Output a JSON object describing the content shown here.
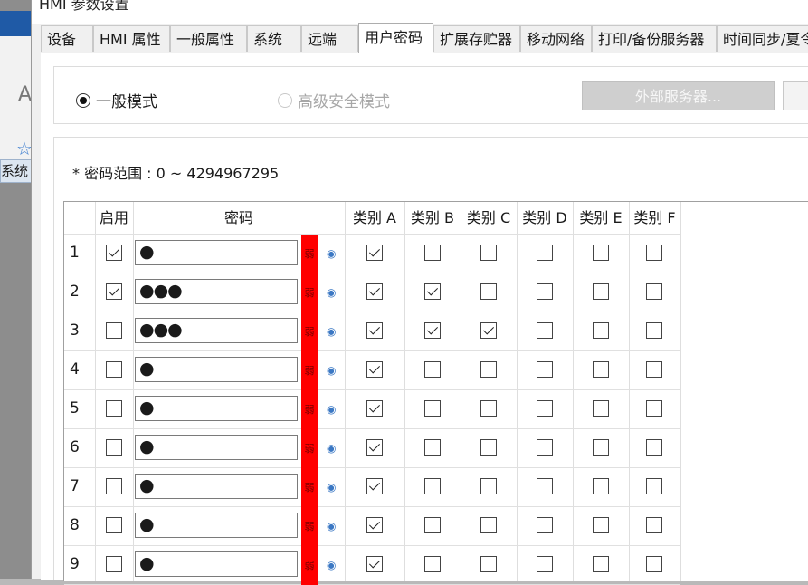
{
  "window": {
    "title": "HMI 参数设置"
  },
  "tabs": [
    "设备",
    "HMI 属性",
    "一般属性",
    "系统",
    "远端",
    "用户密码",
    "扩展存贮器",
    "移动网络",
    "打印/备份服务器",
    "时间同步/夏令"
  ],
  "active_tab": "用户密码",
  "background": {
    "left_tab": "系统"
  },
  "mode": {
    "general_label": "一般模式",
    "secure_label": "高级安全模式",
    "selected": "一般模式",
    "external_server_label": "外部服务器..."
  },
  "range_text": "* 密码范围 : 0 ~ 4294967295",
  "table": {
    "headers": {
      "enable": "启用",
      "password": "密码",
      "categories": [
        "类别 A",
        "类别 B",
        "类别 C",
        "类别 D",
        "类别 E",
        "类别 F"
      ]
    },
    "strength_label": "弱",
    "rows": [
      {
        "num": "1",
        "enabled": true,
        "password": "●",
        "cats": [
          true,
          false,
          false,
          false,
          false,
          false
        ]
      },
      {
        "num": "2",
        "enabled": true,
        "password": "●●●",
        "cats": [
          true,
          true,
          false,
          false,
          false,
          false
        ]
      },
      {
        "num": "3",
        "enabled": false,
        "password": "●●●",
        "cats": [
          true,
          true,
          true,
          false,
          false,
          false
        ]
      },
      {
        "num": "4",
        "enabled": false,
        "password": "●",
        "cats": [
          true,
          false,
          false,
          false,
          false,
          false
        ]
      },
      {
        "num": "5",
        "enabled": false,
        "password": "●",
        "cats": [
          true,
          false,
          false,
          false,
          false,
          false
        ]
      },
      {
        "num": "6",
        "enabled": false,
        "password": "●",
        "cats": [
          true,
          false,
          false,
          false,
          false,
          false
        ]
      },
      {
        "num": "7",
        "enabled": false,
        "password": "●",
        "cats": [
          true,
          false,
          false,
          false,
          false,
          false
        ]
      },
      {
        "num": "8",
        "enabled": false,
        "password": "●",
        "cats": [
          true,
          false,
          false,
          false,
          false,
          false
        ]
      },
      {
        "num": "9",
        "enabled": false,
        "password": "●",
        "cats": [
          true,
          false,
          false,
          false,
          false,
          false
        ]
      }
    ]
  },
  "colors": {
    "strength_weak": "#ff0000",
    "eye_icon": "#3b78c4"
  }
}
